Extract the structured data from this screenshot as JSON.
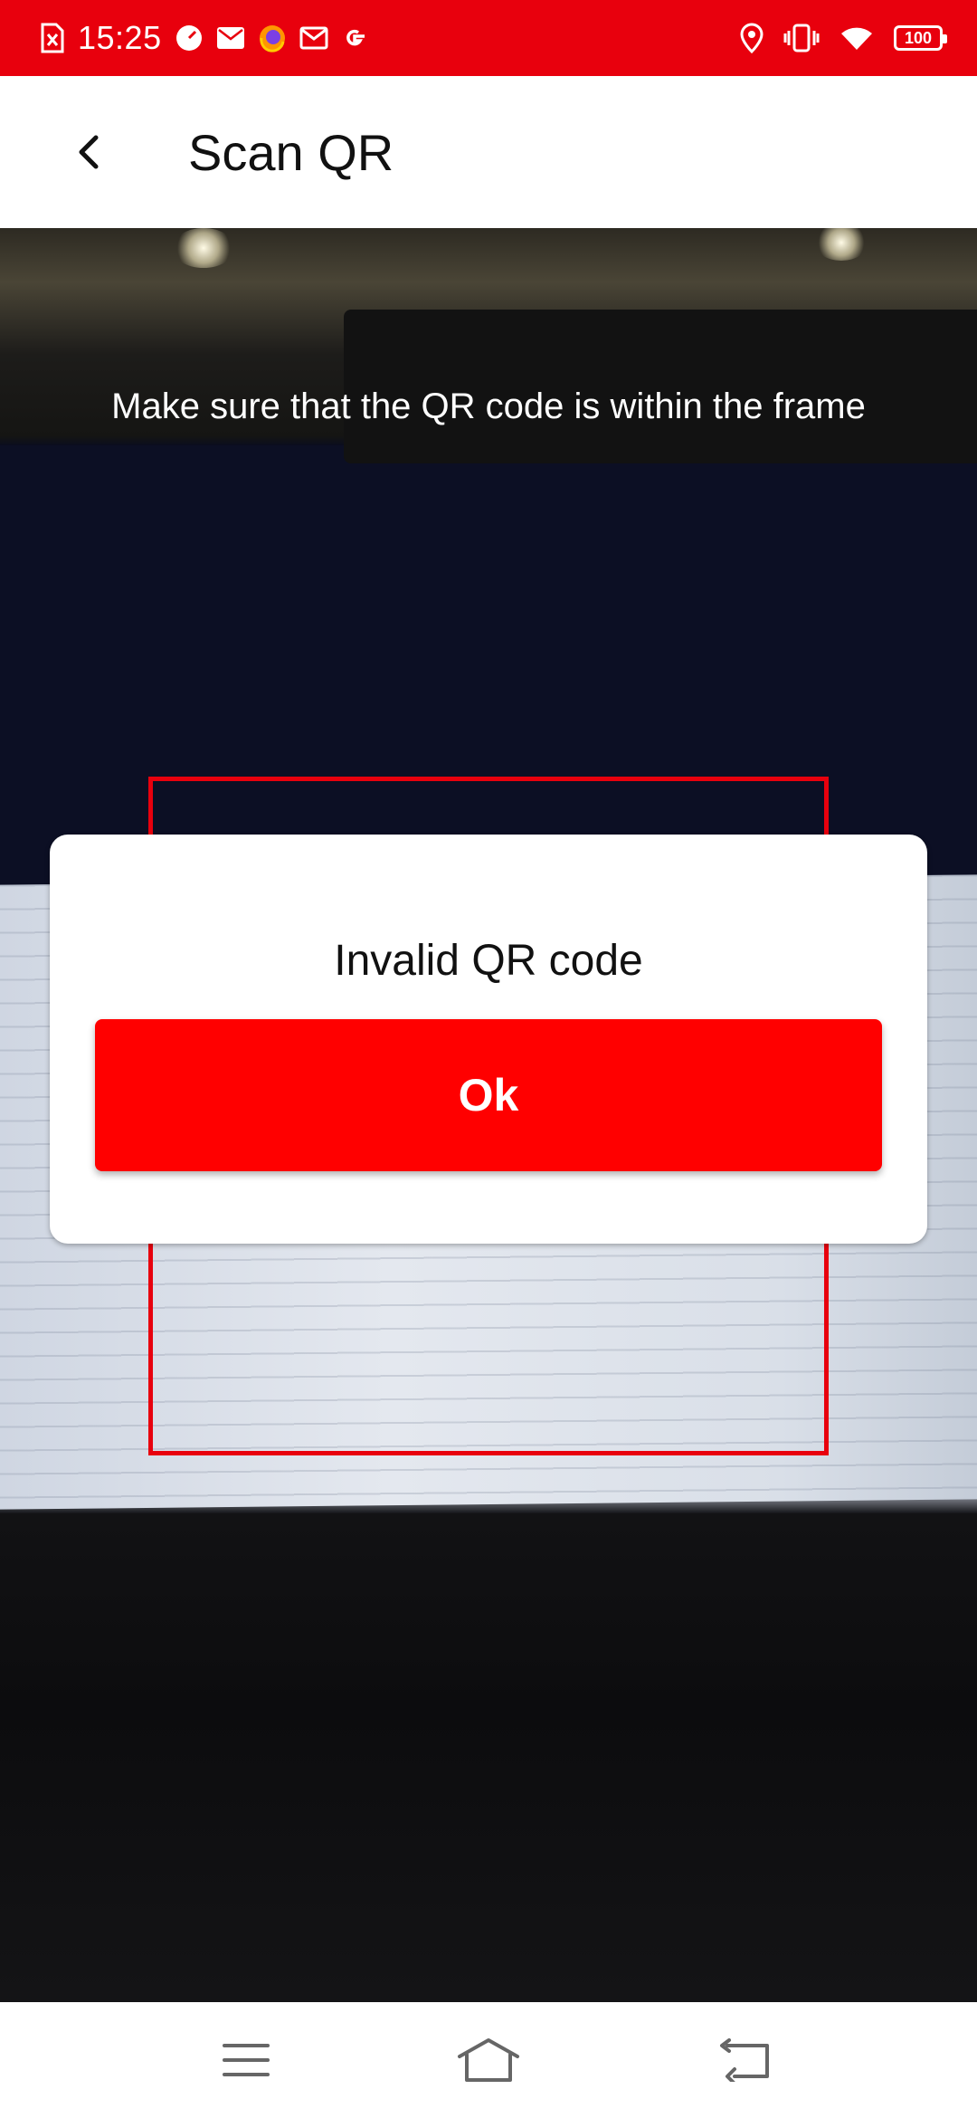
{
  "status_bar": {
    "time": "15:25",
    "battery": "100",
    "background_color": "#e8000d",
    "left_icons": [
      "sim-off-icon",
      "speedometer-icon",
      "mail-icon",
      "firefox-icon",
      "gmail-icon",
      "google-icon"
    ],
    "right_icons": [
      "location-icon",
      "vibrate-icon",
      "wifi-icon",
      "battery-icon"
    ]
  },
  "app_bar": {
    "back_icon": "chevron-left-icon",
    "title": "Scan QR"
  },
  "scanner": {
    "instruction": "Make sure that the QR code is within the frame",
    "frame_color": "#e8000d"
  },
  "dialog": {
    "message": "Invalid QR code",
    "ok_label": "Ok",
    "button_color": "#ff0000"
  },
  "nav_bar": {
    "icons": [
      "menu-icon",
      "home-icon",
      "back-icon"
    ]
  }
}
